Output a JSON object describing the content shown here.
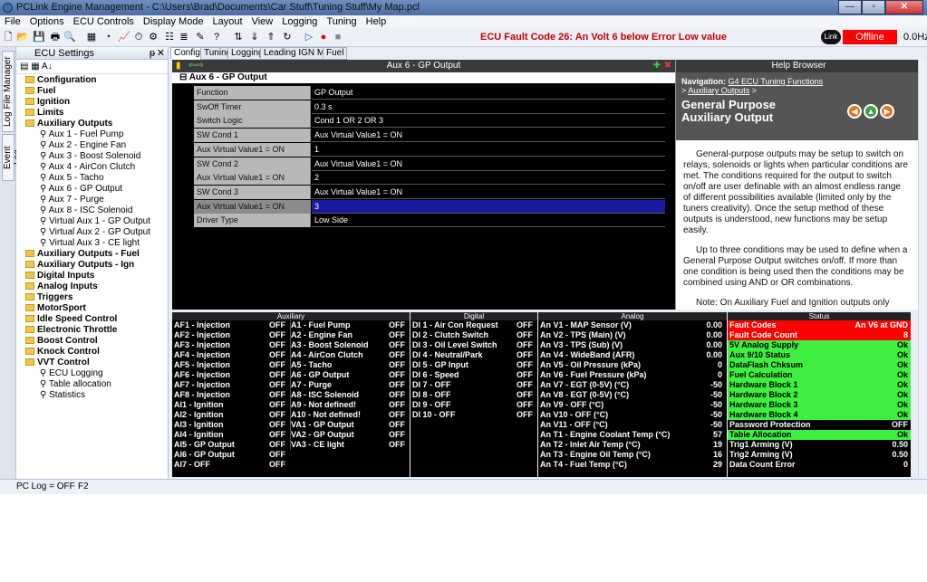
{
  "window": {
    "title": "PCLink Engine Management - C:\\Users\\Brad\\Documents\\Car Stuff\\Tuning Stuff\\My Map.pcl",
    "min": "—",
    "max": "▫",
    "close": "✕"
  },
  "menu": [
    "File",
    "Options",
    "ECU Controls",
    "Display Mode",
    "Layout",
    "View",
    "Logging",
    "Tuning",
    "Help"
  ],
  "toolbar": {
    "fault_text": "ECU Fault Code 26: An Volt 6 below Error Low value",
    "status": "Offline",
    "rate": "0.0Hz",
    "link_logo": "Link"
  },
  "side_tabs": [
    "Log File Manager",
    "Event Log"
  ],
  "ecu_panel": {
    "title": "ECU Settings",
    "pin": "ᵽ",
    "close": "✕",
    "sort": "A↓",
    "items": [
      {
        "label": "Configuration",
        "lvl": 1,
        "bold": true
      },
      {
        "label": "Fuel",
        "lvl": 1,
        "bold": true
      },
      {
        "label": "Ignition",
        "lvl": 1,
        "bold": true
      },
      {
        "label": "Limits",
        "lvl": 1,
        "bold": true
      },
      {
        "label": "Auxiliary Outputs",
        "lvl": 1,
        "bold": true
      },
      {
        "label": "Aux  1 - Fuel Pump",
        "lvl": 2
      },
      {
        "label": "Aux  2 - Engine Fan",
        "lvl": 2
      },
      {
        "label": "Aux  3 - Boost Solenoid",
        "lvl": 2
      },
      {
        "label": "Aux  4 - AirCon Clutch",
        "lvl": 2
      },
      {
        "label": "Aux  5 - Tacho",
        "lvl": 2
      },
      {
        "label": "Aux  6 - GP Output",
        "lvl": 2
      },
      {
        "label": "Aux  7 - Purge",
        "lvl": 2
      },
      {
        "label": "Aux  8 - ISC Solenoid",
        "lvl": 2
      },
      {
        "label": "Virtual Aux  1 - GP Output",
        "lvl": 2
      },
      {
        "label": "Virtual Aux  2 - GP Output",
        "lvl": 2
      },
      {
        "label": "Virtual Aux  3 - CE light",
        "lvl": 2
      },
      {
        "label": "Auxiliary Outputs - Fuel",
        "lvl": 1,
        "bold": true
      },
      {
        "label": "Auxiliary Outputs - Ign",
        "lvl": 1,
        "bold": true
      },
      {
        "label": "Digital Inputs",
        "lvl": 1,
        "bold": true
      },
      {
        "label": "Analog Inputs",
        "lvl": 1,
        "bold": true
      },
      {
        "label": "Triggers",
        "lvl": 1,
        "bold": true
      },
      {
        "label": "MotorSport",
        "lvl": 1,
        "bold": true
      },
      {
        "label": "Idle Speed Control",
        "lvl": 1,
        "bold": true
      },
      {
        "label": "Electronic Throttle",
        "lvl": 1,
        "bold": true
      },
      {
        "label": "Boost Control",
        "lvl": 1,
        "bold": true
      },
      {
        "label": "Knock Control",
        "lvl": 1,
        "bold": true
      },
      {
        "label": "VVT Control",
        "lvl": 1,
        "bold": true
      },
      {
        "label": "ECU Logging",
        "lvl": 2
      },
      {
        "label": "Table allocation",
        "lvl": 2
      },
      {
        "label": "Statistics",
        "lvl": 2
      }
    ]
  },
  "tabs": [
    "Config",
    "Tuning",
    "Logging",
    "Leading IGN Map",
    "Fuel"
  ],
  "main": {
    "header": "Aux  6 - GP Output",
    "section": "Aux  6 - GP Output",
    "props": [
      {
        "k": "Function",
        "v": "GP Output"
      },
      {
        "k": "SwOff Timer",
        "v": "0.3 s"
      },
      {
        "k": "Switch Logic",
        "v": "Cond 1 OR 2 OR 3"
      },
      {
        "k": "SW Cond 1",
        "v": "Aux Virtual Value1 =  ON"
      },
      {
        "k": "Aux Virtual Value1 =  ON",
        "v": "1"
      },
      {
        "k": "SW Cond 2",
        "v": "Aux Virtual Value1 =  ON"
      },
      {
        "k": "Aux Virtual Value1 =  ON",
        "v": "2"
      },
      {
        "k": "SW Cond 3",
        "v": "Aux Virtual Value1 =  ON"
      },
      {
        "k": "Aux Virtual Value1 =  ON",
        "v": "3",
        "sel": true
      },
      {
        "k": "Driver Type",
        "v": "Low Side"
      }
    ]
  },
  "help": {
    "title": "Help Browser",
    "nav_label": "Navigation:",
    "nav_link1": "G4 ECU Tuning Functions",
    "nav_link2": "Auxiliary Outputs",
    "heading": "General Purpose Auxiliary Output",
    "p1": "General-purpose outputs may be setup to switch on relays, solenoids or lights when particular conditions are met.  The conditions required for the output to switch on/off are user definable with an almost endless range of different possibilities available (limited only by the tuners creativity).  Once the setup method of these outputs is understood, new functions may be setup easily.",
    "p2": "Up to three conditions may be used to define when a General Purpose Output switches on/off.  If more than one condition is being used then the conditions may be combined using AND or OR combinations.",
    "p3": "Note: On Auxiliary Fuel and Ignition outputs only"
  },
  "auxiliary": {
    "title": "Auxiliary",
    "left": [
      [
        "AF1 - Injection",
        "OFF"
      ],
      [
        "AF2 - Injection",
        "OFF"
      ],
      [
        "AF3 - Injection",
        "OFF"
      ],
      [
        "AF4 - Injection",
        "OFF"
      ],
      [
        "AF5 - Injection",
        "OFF"
      ],
      [
        "AF6 - Injection",
        "OFF"
      ],
      [
        "AF7 - Injection",
        "OFF"
      ],
      [
        "AF8 - Injection",
        "OFF"
      ],
      [
        "AI1 - Ignition",
        "OFF"
      ],
      [
        "AI2 - Ignition",
        "OFF"
      ],
      [
        "AI3 - Ignition",
        "OFF"
      ],
      [
        "AI4 - Ignition",
        "OFF"
      ],
      [
        "AI5 - GP Output",
        "OFF"
      ],
      [
        "AI6 - GP Output",
        "OFF"
      ],
      [
        "AI7 - OFF",
        "OFF"
      ]
    ],
    "right": [
      [
        "A1 - Fuel Pump",
        "OFF"
      ],
      [
        "A2 - Engine Fan",
        "OFF"
      ],
      [
        "A3 - Boost Solenoid",
        "OFF"
      ],
      [
        "A4 - AirCon Clutch",
        "OFF"
      ],
      [
        "A5 - Tacho",
        "OFF"
      ],
      [
        "A6 - GP Output",
        "OFF"
      ],
      [
        "A7 - Purge",
        "OFF"
      ],
      [
        "A8 - ISC Solenoid",
        "OFF"
      ],
      [
        "A9 - Not defined!",
        "OFF"
      ],
      [
        "A10 - Not defined!",
        "OFF"
      ],
      [
        "VA1 - GP Output",
        "OFF"
      ],
      [
        "VA2 - GP Output",
        "OFF"
      ],
      [
        "VA3 - CE light",
        "OFF"
      ]
    ]
  },
  "digital": {
    "title": "Digital",
    "rows": [
      [
        "DI 1 - Air Con Request",
        "OFF"
      ],
      [
        "DI 2 - Clutch Switch",
        "OFF"
      ],
      [
        "DI 3 - Oil Level Switch",
        "OFF"
      ],
      [
        "DI 4 - Neutral/Park",
        "OFF"
      ],
      [
        "DI 5 - GP Input",
        "OFF"
      ],
      [
        "DI 6 - Speed",
        "OFF"
      ],
      [
        "DI 7 - OFF",
        "OFF"
      ],
      [
        "DI 8 - OFF",
        "OFF"
      ],
      [
        "DI 9 - OFF",
        "OFF"
      ],
      [
        "DI 10 - OFF",
        "OFF"
      ]
    ]
  },
  "analog": {
    "title": "Analog",
    "rows": [
      [
        "An V1 - MAP Sensor (V)",
        "0.00"
      ],
      [
        "An V2 - TPS (Main) (V)",
        "0.00"
      ],
      [
        "An V3 - TPS (Sub) (V)",
        "0.00"
      ],
      [
        "An V4 - WideBand (AFR)",
        "0.00"
      ],
      [
        "An V5 - Oil Pressure (kPa)",
        "0"
      ],
      [
        "An V6 - Fuel Pressure (kPa)",
        "0"
      ],
      [
        "An V7 - EGT (0-5V) (°C)",
        "-50"
      ],
      [
        "An V8 - EGT (0-5V) (°C)",
        "-50"
      ],
      [
        "An V9 - OFF (°C)",
        "-50"
      ],
      [
        "An V10 - OFF (°C)",
        "-50"
      ],
      [
        "An V11 - OFF (°C)",
        "-50"
      ],
      [
        "An T1 - Engine Coolant Temp (°C)",
        "57"
      ],
      [
        "An T2 - Inlet Air Temp (°C)",
        "19"
      ],
      [
        "An T3 - Engine Oil Temp (°C)",
        "16"
      ],
      [
        "An T4 - Fuel Temp (°C)",
        "29"
      ]
    ]
  },
  "status": {
    "title": "Status",
    "rows": [
      [
        "Fault Codes",
        "An V6 at GND",
        "red"
      ],
      [
        "Fault Code Count",
        "8",
        "red"
      ],
      [
        "5V Analog Supply",
        "Ok",
        "grn"
      ],
      [
        "Aux 9/10 Status",
        "Ok",
        "grn"
      ],
      [
        "DataFlash Chksum",
        "Ok",
        "grn"
      ],
      [
        "Fuel Calculation",
        "Ok",
        "grn"
      ],
      [
        "Hardware Block 1",
        "Ok",
        "grn"
      ],
      [
        "Hardware Block 2",
        "Ok",
        "grn"
      ],
      [
        "Hardware Block 3",
        "Ok",
        "grn"
      ],
      [
        "Hardware Block 4",
        "Ok",
        "grn"
      ],
      [
        "Password Protection",
        "OFF",
        "blk"
      ],
      [
        "Table Allocation",
        "Ok",
        "grn"
      ],
      [
        "Trig1 Arming (V)",
        "0.50",
        "blk"
      ],
      [
        "Trig2 Arming (V)",
        "0.50",
        "blk"
      ],
      [
        "Data Count Error",
        "0",
        "blk"
      ]
    ]
  },
  "statusbar": {
    "pclog": "PC Log = OFF",
    "f2": "F2"
  },
  "colors": {
    "accent": "#3fef3f",
    "fault": "#ff0000",
    "selected": "#1a1a9e"
  }
}
